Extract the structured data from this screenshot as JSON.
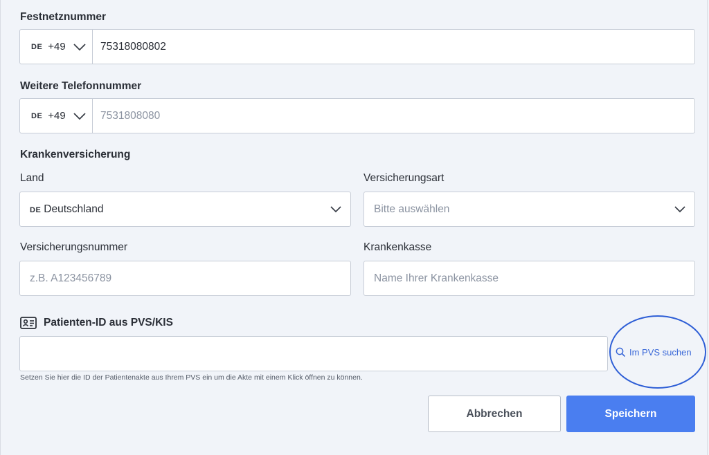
{
  "landline": {
    "label": "Festnetznummer",
    "country_code": "DE",
    "dial_code": "+49",
    "value": "75318080802"
  },
  "other_phone": {
    "label": "Weitere Telefonnummer",
    "country_code": "DE",
    "dial_code": "+49",
    "placeholder": "7531808080"
  },
  "insurance": {
    "section_label": "Krankenversicherung",
    "country": {
      "label": "Land",
      "country_code": "DE",
      "value": "Deutschland"
    },
    "type": {
      "label": "Versicherungsart",
      "placeholder": "Bitte auswählen"
    },
    "number": {
      "label": "Versicherungsnummer",
      "placeholder": "z.B. A123456789"
    },
    "provider": {
      "label": "Krankenkasse",
      "placeholder": "Name Ihrer Krankenkasse"
    }
  },
  "patient_id": {
    "label": "Patienten-ID aus PVS/KIS",
    "value": "",
    "hint": "Setzen Sie hier die ID der Patientenakte aus Ihrem PVS ein um die Akte mit einem Klick öffnen zu können.",
    "search_link": "Im PVS suchen"
  },
  "actions": {
    "cancel_label": "Abbrechen",
    "save_label": "Speichern"
  },
  "colors": {
    "accent": "#4a7ef0",
    "link": "#3a68d8",
    "highlight_circle": "#2f5fd6",
    "background": "#f1f4f9"
  },
  "icons": [
    "chevron-down-icon",
    "id-card-icon",
    "search-icon"
  ]
}
